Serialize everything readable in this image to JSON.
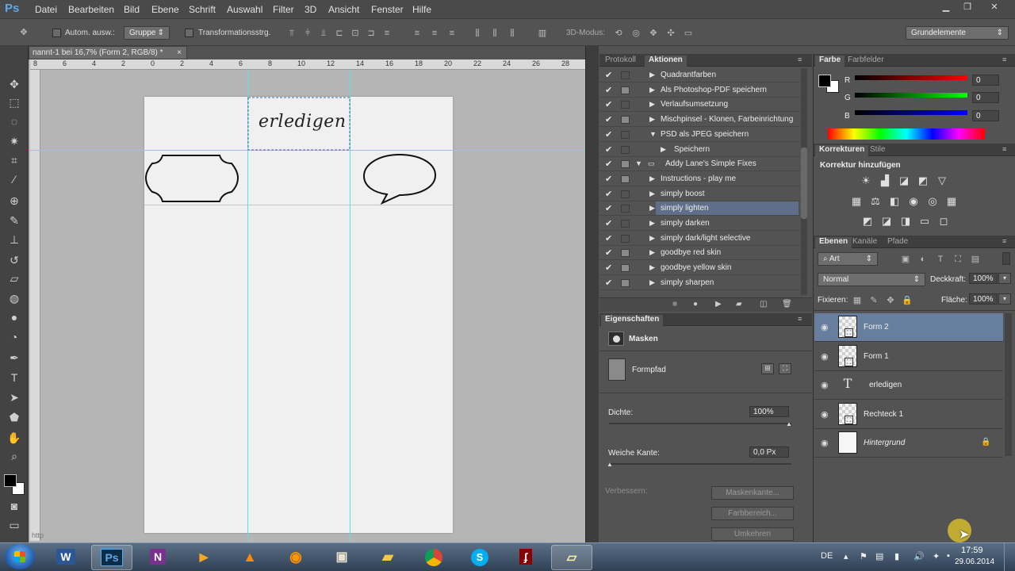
{
  "app": {
    "logo": "Ps"
  },
  "menu": [
    "Datei",
    "Bearbeiten",
    "Bild",
    "Ebene",
    "Schrift",
    "Auswahl",
    "Filter",
    "3D",
    "Ansicht",
    "Fenster",
    "Hilfe"
  ],
  "options": {
    "auto_select_label": "Autom. ausw.:",
    "auto_select_value": "Gruppe",
    "transform_label": "Transformationsstrg.",
    "mode_3d_label": "3D-Modus:",
    "workspace": "Grundelemente"
  },
  "document": {
    "tab_title": "nannt-1 bei 16,7% (Form 2, RGB/8) *",
    "ruler_numbers": [
      "8",
      "6",
      "4",
      "2",
      "0",
      "2",
      "4",
      "6",
      "8",
      "10",
      "12",
      "14",
      "16",
      "18",
      "20",
      "22",
      "24",
      "26",
      "28"
    ],
    "text_layer": "erledigen",
    "status": "http"
  },
  "actions_panel": {
    "tabs": [
      "Protokoll",
      "Aktionen"
    ],
    "rows": [
      {
        "label": "Quadrantfarben",
        "check": "✔",
        "dialog": false,
        "expanded": false,
        "indent": 0
      },
      {
        "label": "Als Photoshop-PDF speichern",
        "check": "✔",
        "dialog": true,
        "expanded": false,
        "indent": 0
      },
      {
        "label": "Verlaufsumsetzung",
        "check": "✔",
        "dialog": false,
        "expanded": false,
        "indent": 0
      },
      {
        "label": "Mischpinsel - Klonen, Farbeinrichtung",
        "check": "✔",
        "dialog": true,
        "expanded": false,
        "indent": 0
      },
      {
        "label": "PSD als JPEG speichern",
        "check": "✔",
        "dialog": false,
        "expanded": true,
        "indent": 0
      },
      {
        "label": "Speichern",
        "check": "✔",
        "dialog": false,
        "expanded": false,
        "indent": 1
      },
      {
        "label": "Addy Lane's Simple Fixes",
        "check": "✔",
        "dialog": true,
        "expanded": true,
        "indent": -1
      },
      {
        "label": "Instructions - play me",
        "check": "✔",
        "dialog": true,
        "expanded": false,
        "indent": 0
      },
      {
        "label": "simply boost",
        "check": "✔",
        "dialog": false,
        "expanded": false,
        "indent": 0
      },
      {
        "label": "simply lighten",
        "check": "✔",
        "dialog": false,
        "expanded": false,
        "indent": 0,
        "selected": true
      },
      {
        "label": "simply darken",
        "check": "✔",
        "dialog": false,
        "expanded": false,
        "indent": 0
      },
      {
        "label": "simply dark/light selective",
        "check": "✔",
        "dialog": false,
        "expanded": false,
        "indent": 0
      },
      {
        "label": "goodbye red skin",
        "check": "✔",
        "dialog": true,
        "expanded": false,
        "indent": 0
      },
      {
        "label": "goodbye yellow skin",
        "check": "✔",
        "dialog": true,
        "expanded": false,
        "indent": 0
      },
      {
        "label": "simply sharpen",
        "check": "✔",
        "dialog": true,
        "expanded": false,
        "indent": 0
      }
    ]
  },
  "properties_panel": {
    "tab": "Eigenschaften",
    "masks_label": "Masken",
    "formpfad_label": "Formpfad",
    "density_label": "Dichte:",
    "density_value": "100%",
    "feather_label": "Weiche Kante:",
    "feather_value": "0,0 Px",
    "refine_label": "Verbessern:",
    "btn_mask_edge": "Maskenkante...",
    "btn_color_range": "Farbbereich...",
    "btn_invert": "Umkehren"
  },
  "color_panel": {
    "tabs": [
      "Farbe",
      "Farbfelder"
    ],
    "channels": [
      {
        "label": "R",
        "value": "0"
      },
      {
        "label": "G",
        "value": "0"
      },
      {
        "label": "B",
        "value": "0"
      }
    ]
  },
  "adjustments_panel": {
    "tabs": [
      "Korrekturen",
      "Stile"
    ],
    "add_label": "Korrektur hinzufügen"
  },
  "layers_panel": {
    "tabs": [
      "Ebenen",
      "Kanäle",
      "Pfade"
    ],
    "filter_kind": "Art",
    "blend_mode": "Normal",
    "opacity_label": "Deckkraft:",
    "opacity_value": "100%",
    "lock_label": "Fixieren:",
    "fill_label": "Fläche:",
    "fill_value": "100%",
    "layers": [
      {
        "name": "Form 2",
        "selected": true,
        "type": "shape"
      },
      {
        "name": "Form 1",
        "selected": false,
        "type": "shape"
      },
      {
        "name": "erledigen",
        "selected": false,
        "type": "text"
      },
      {
        "name": "Rechteck 1",
        "selected": false,
        "type": "shape"
      },
      {
        "name": "Hintergrund",
        "selected": false,
        "type": "background"
      }
    ]
  },
  "taskbar": {
    "lang": "DE",
    "time": "17:59",
    "date": "29.06.2014"
  }
}
